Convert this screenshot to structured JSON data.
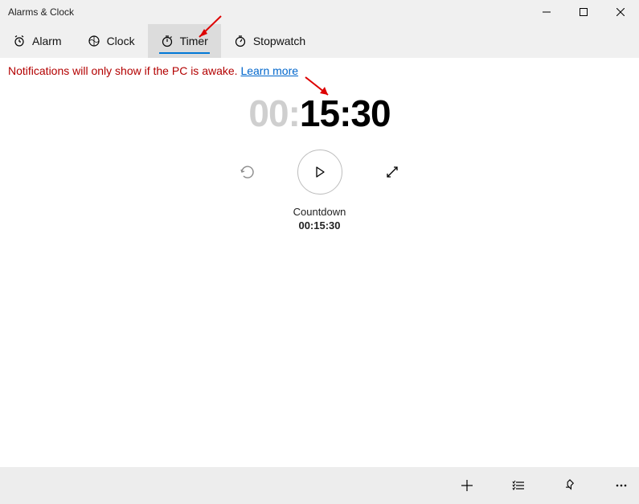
{
  "window": {
    "title": "Alarms & Clock"
  },
  "tabs": {
    "alarm": "Alarm",
    "clock": "Clock",
    "timer": "Timer",
    "stopwatch": "Stopwatch"
  },
  "notice": {
    "text": "Notifications will only show if the PC is awake. ",
    "link": "Learn more"
  },
  "timer": {
    "display_dim": "00:",
    "display_bold": "15:30",
    "label": "Countdown",
    "value": "00:15:30"
  }
}
